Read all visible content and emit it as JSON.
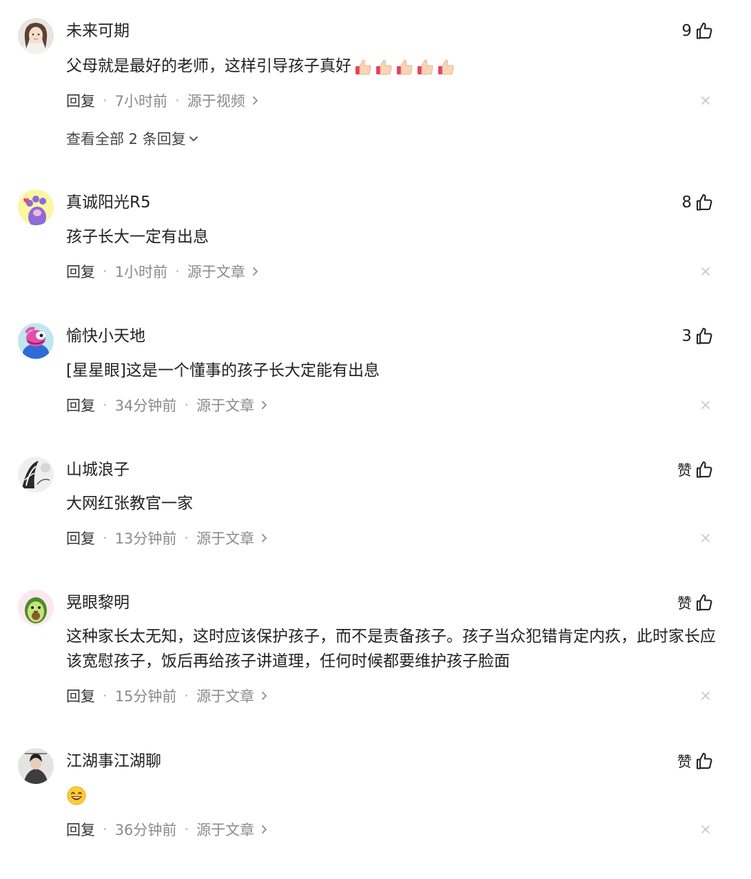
{
  "comments": [
    {
      "username": "未来可期",
      "likes": "9",
      "text": "父母就是最好的老师，这样引导孩子真好",
      "trailing_emoji": "thumbs-up x5",
      "time": "7小时前",
      "source": "源于视频",
      "view_replies": "查看全部 2 条回复"
    },
    {
      "username": "真诚阳光R5",
      "likes": "8",
      "text": "孩子长大一定有出息",
      "time": "1小时前",
      "source": "源于文章"
    },
    {
      "username": "愉快小天地",
      "likes": "3",
      "text": "[星星眼]这是一个懂事的孩子长大定能有出息",
      "time": "34分钟前",
      "source": "源于文章"
    },
    {
      "username": "山城浪子",
      "likes": "赞",
      "text": "大网红张教官一家",
      "time": "13分钟前",
      "source": "源于文章"
    },
    {
      "username": "晃眼黎明",
      "likes": "赞",
      "text": "这种家长太无知，这时应该保护孩子，而不是责备孩子。孩子当众犯错肯定内疚，此时家长应该宽慰孩子，饭后再给孩子讲道理，任何时候都要维护孩子脸面",
      "time": "15分钟前",
      "source": "源于文章"
    },
    {
      "username": "江湖事江湖聊",
      "likes": "赞",
      "text": "",
      "emoji": "grinning-face",
      "time": "36分钟前",
      "source": "源于文章"
    }
  ],
  "labels": {
    "reply": "回复",
    "separator": "·"
  },
  "colors": {
    "text": "#222222",
    "meta": "#8a8a8a",
    "separator": "#b5b5b5",
    "close": "#c8c8c8"
  }
}
